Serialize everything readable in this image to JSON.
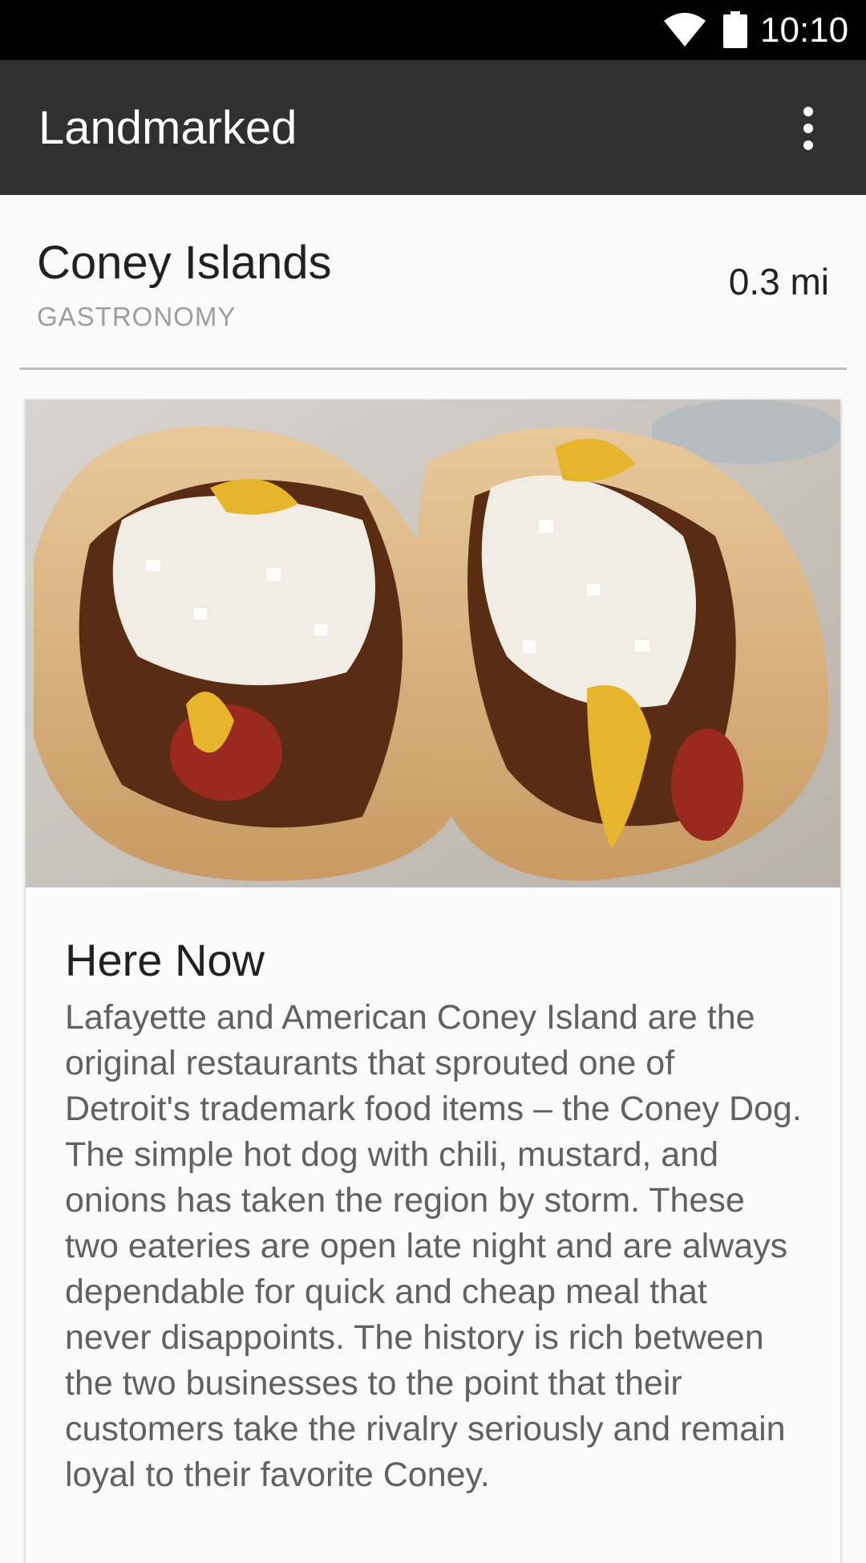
{
  "status_bar": {
    "time": "10:10"
  },
  "app_bar": {
    "title": "Landmarked",
    "menu_icon": "more-vert-icon"
  },
  "place": {
    "name": "Coney Islands",
    "category": "GASTRONOMY",
    "distance": "0.3 mi"
  },
  "card": {
    "section_title": "Here Now",
    "description": "Lafayette and American Coney Island are the original restaurants that sprouted one of Detroit's trademark food items – the Coney Dog. The simple hot dog with chili, mustard, and onions has taken the region by storm. These two eateries are open late night and are always dependable for quick and cheap meal that never disappoints. The history is rich between the two businesses to the point that their customers take the rivalry seriously and remain loyal to their favorite Coney."
  }
}
